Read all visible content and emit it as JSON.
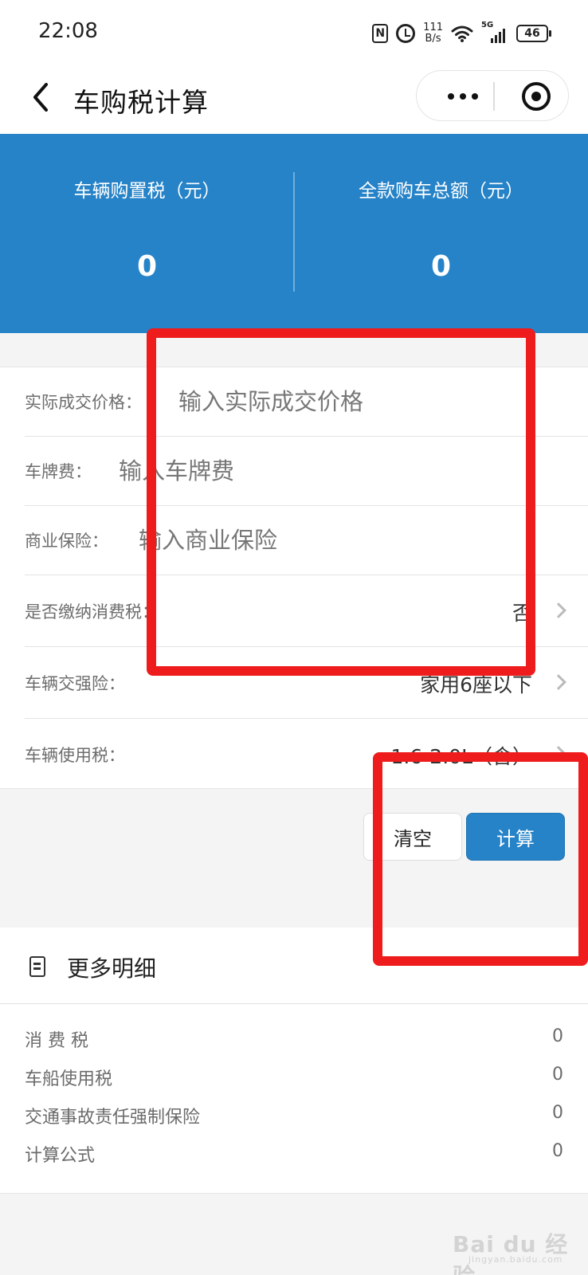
{
  "status_bar": {
    "time": "22:08",
    "speed_top": "111",
    "speed_bottom": "B/s",
    "network": "5G",
    "battery": "46"
  },
  "nav": {
    "title": "车购税计算"
  },
  "summary": {
    "tax_label": "车辆购置税（元）",
    "tax_value": "0",
    "total_label": "全款购车总额（元）",
    "total_value": "0"
  },
  "form": {
    "price": {
      "label": "实际成交价格：",
      "placeholder": "输入实际成交价格"
    },
    "plate_fee": {
      "label": "车牌费：",
      "placeholder": "输入车牌费"
    },
    "insurance": {
      "label": "商业保险：",
      "placeholder": "输入商业保险"
    },
    "consumption_tax": {
      "label": "是否缴纳消费税：",
      "value": "否"
    },
    "compulsory_insurance": {
      "label": "车辆交强险：",
      "value": "家用6座以下"
    },
    "usage_tax": {
      "label": "车辆使用税：",
      "value": "1.6-2.0L（含）"
    }
  },
  "actions": {
    "clear_label": "清空",
    "calculate_label": "计算"
  },
  "details": {
    "title": "更多明细",
    "rows": [
      {
        "label": "消 费 税",
        "value": "0"
      },
      {
        "label": "车船使用税",
        "value": "0"
      },
      {
        "label": "交通事故责任强制保险",
        "value": "0"
      },
      {
        "label": "计算公式",
        "value": "0"
      }
    ]
  },
  "watermark": {
    "text": "Bai du 经验",
    "sub": "jingyan.baidu.com"
  },
  "colors": {
    "brand_blue": "#2683c8",
    "highlight_red": "#ee1c1c"
  }
}
